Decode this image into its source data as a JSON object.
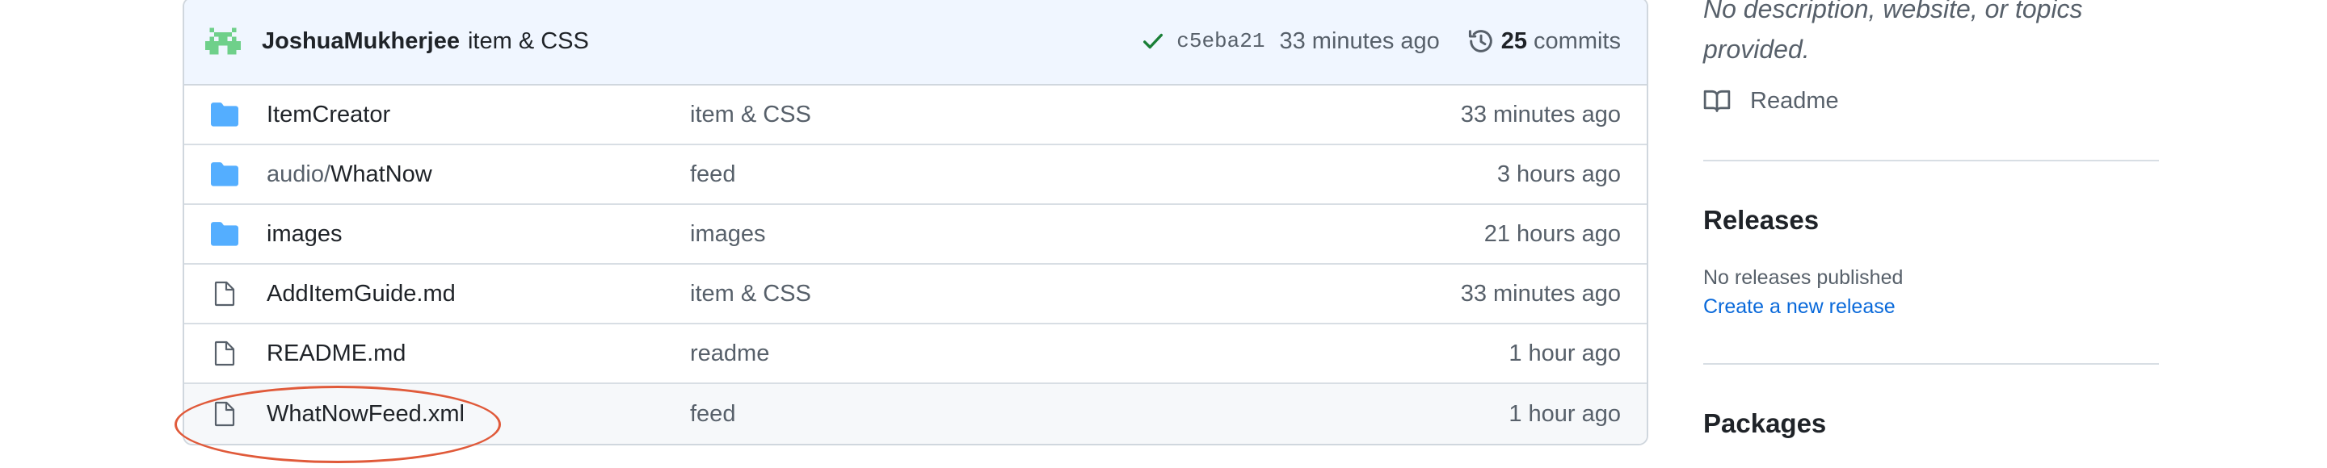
{
  "colors": {
    "accent": "#0969da",
    "folder": "#54aeff",
    "check": "#1a7f37",
    "annotation": "#e05a3a",
    "header_bg": "#f0f6ff"
  },
  "commit": {
    "author": "JoshuaMukherjee",
    "message": "item & CSS",
    "sha": "c5eba21",
    "time": "33 minutes ago",
    "commits_count": "25",
    "commits_label": "commits"
  },
  "files": [
    {
      "type": "folder",
      "prefix": "",
      "name": "ItemCreator",
      "message": "item & CSS",
      "time": "33 minutes ago"
    },
    {
      "type": "folder",
      "prefix": "audio/",
      "name": "WhatNow",
      "message": "feed",
      "time": "3 hours ago"
    },
    {
      "type": "folder",
      "prefix": "",
      "name": "images",
      "message": "images",
      "time": "21 hours ago"
    },
    {
      "type": "file",
      "prefix": "",
      "name": "AddItemGuide.md",
      "message": "item & CSS",
      "time": "33 minutes ago"
    },
    {
      "type": "file",
      "prefix": "",
      "name": "README.md",
      "message": "readme",
      "time": "1 hour ago"
    },
    {
      "type": "file",
      "prefix": "",
      "name": "WhatNowFeed.xml",
      "message": "feed",
      "time": "1 hour ago"
    }
  ],
  "sidebar": {
    "about_description": "No description, website, or topics provided.",
    "readme_label": "Readme",
    "releases_title": "Releases",
    "releases_none": "No releases published",
    "releases_create": "Create a new release",
    "packages_title": "Packages"
  }
}
